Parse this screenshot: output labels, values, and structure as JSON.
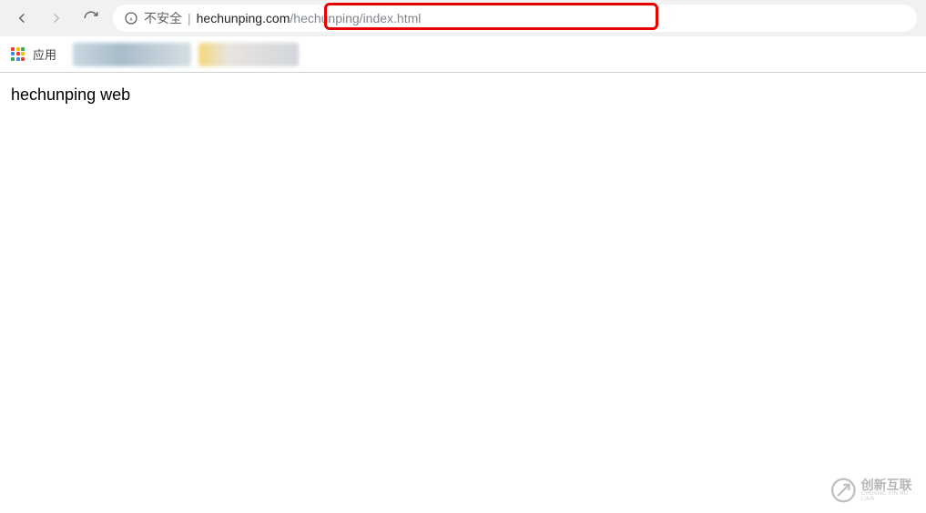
{
  "toolbar": {
    "security_label": "不安全",
    "url_host": "hechunping.com",
    "url_path": "/hechunping/index.html"
  },
  "bookmarks": {
    "apps_label": "应用"
  },
  "page": {
    "body_text": "hechunping web"
  },
  "watermark": {
    "cn": "创新互联",
    "en": "CHUANG XIN HU LIAN"
  },
  "icons": {
    "back": "back-icon",
    "forward": "forward-icon",
    "reload": "reload-icon",
    "info": "info-icon",
    "apps": "apps-grid-icon"
  }
}
